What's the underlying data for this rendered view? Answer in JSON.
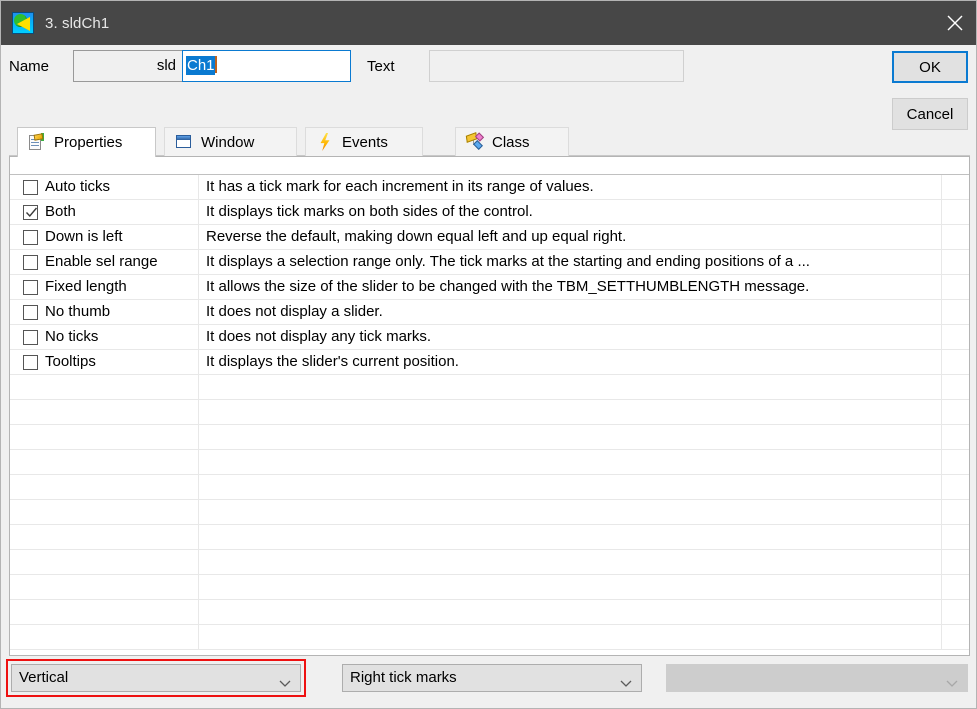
{
  "window": {
    "title": "3. sldCh1",
    "icon": "slider-control-icon",
    "close_label": "close-icon"
  },
  "form": {
    "name_label": "Name",
    "name_prefix": "sld",
    "name_value": "Ch1",
    "text_label": "Text",
    "text_value": ""
  },
  "buttons": {
    "ok": "OK",
    "cancel": "Cancel"
  },
  "tabs": [
    {
      "label": "Properties",
      "icon": "properties-icon",
      "active": true
    },
    {
      "label": "Window",
      "icon": "window-icon",
      "active": false
    },
    {
      "label": "Events",
      "icon": "lightning-icon",
      "active": false
    },
    {
      "label": "Class",
      "icon": "class-diamonds-icon",
      "active": false
    }
  ],
  "properties": [
    {
      "name": "Auto ticks",
      "checked": false,
      "description": "It has a tick mark for each increment in its range of values."
    },
    {
      "name": "Both",
      "checked": true,
      "description": "It displays tick marks on both sides of the control."
    },
    {
      "name": "Down is left",
      "checked": false,
      "description": "Reverse the default, making down equal left and up equal right."
    },
    {
      "name": "Enable sel range",
      "checked": false,
      "description": "It displays a selection range only. The tick marks at the starting and ending positions of a ..."
    },
    {
      "name": "Fixed length",
      "checked": false,
      "description": "It allows the size of the slider to be changed with the TBM_SETTHUMBLENGTH message."
    },
    {
      "name": "No thumb",
      "checked": false,
      "description": "It does not display a slider."
    },
    {
      "name": "No ticks",
      "checked": false,
      "description": "It does not display any tick marks."
    },
    {
      "name": "Tooltips",
      "checked": false,
      "description": "It displays the slider's current position."
    }
  ],
  "empty_row_count": 11,
  "combos": {
    "orientation": {
      "value": "Vertical",
      "highlighted": true
    },
    "tickmarks": {
      "value": "Right tick marks",
      "highlighted": false
    },
    "third": {
      "value": "",
      "disabled": true
    }
  },
  "colors": {
    "titlebar": "#474747",
    "accent": "#0a7ad1",
    "highlight": "#ee1111",
    "dialog_bg": "#f0f0f0",
    "control_bg": "#e1e1e1"
  }
}
